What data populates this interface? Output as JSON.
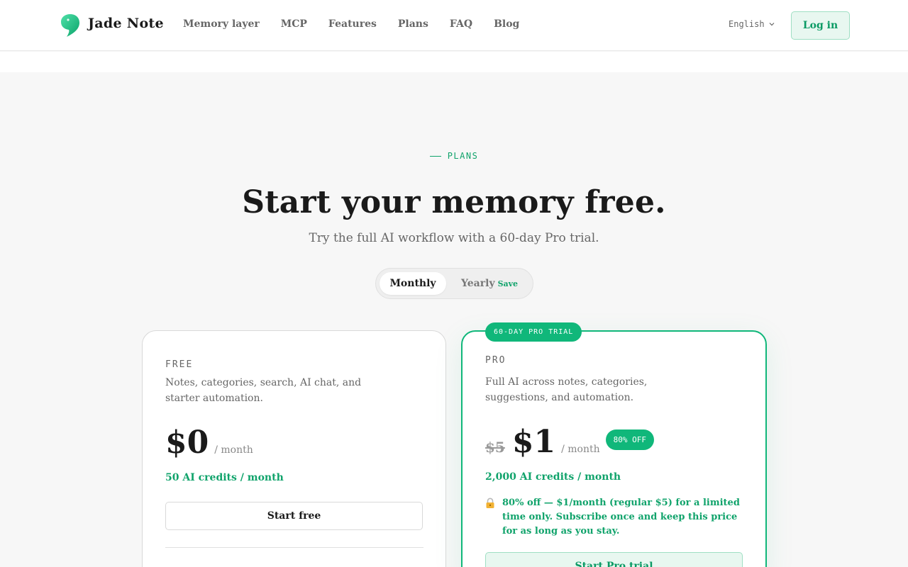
{
  "header": {
    "brand": "Jade Note",
    "nav": [
      "Memory layer",
      "MCP",
      "Features",
      "Plans",
      "FAQ",
      "Blog"
    ],
    "language": "English",
    "login_label": "Log in"
  },
  "hero": {
    "eyebrow": "PLANS",
    "title": "Start your memory free.",
    "subtitle": "Try the full AI workflow with a 60-day Pro trial.",
    "toggle": {
      "monthly_label": "Monthly",
      "yearly_label": "Yearly",
      "save_label": "Save",
      "selected": "Monthly"
    }
  },
  "plans": {
    "free": {
      "name": "FREE",
      "description": "Notes, categories, search, AI chat, and starter automation.",
      "price": "$0",
      "period": "/ month",
      "credits": "50 AI credits / month",
      "cta": "Start free"
    },
    "pro": {
      "badge": "60-DAY PRO TRIAL",
      "name": "PRO",
      "description": "Full AI across notes, categories, suggestions, and automation.",
      "old_price": "$5",
      "price": "$1",
      "period": "/ month",
      "discount": "80% OFF",
      "credits": "2,000 AI credits / month",
      "promo": "80% off — $1/month (regular $5) for a limited time only. Subscribe once and keep this price for as long as you stay.",
      "cta": "Start Pro trial"
    }
  },
  "colors": {
    "accent": "#10b77a",
    "accent_text": "#10a36b",
    "background": "#f7f7f7"
  }
}
